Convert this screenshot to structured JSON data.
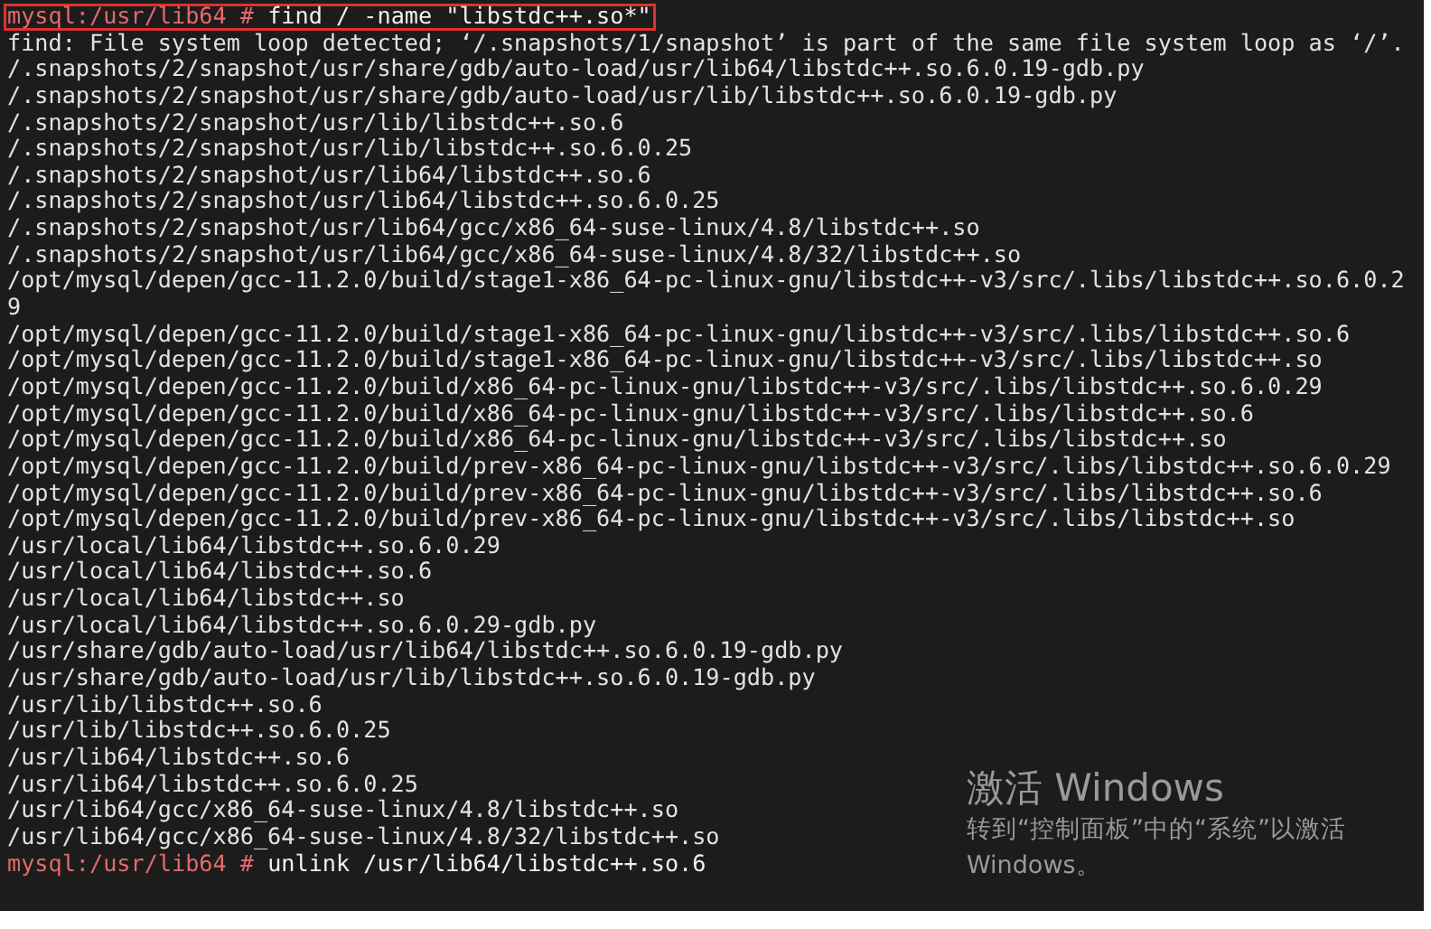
{
  "terminal": {
    "lines": [
      {
        "kind": "prompt",
        "prompt": "mysql:/usr/lib64 #",
        "command": "find / -name \"libstdc++.so*\"",
        "highlighted": true
      },
      {
        "kind": "output",
        "text": "find: File system loop detected; ‘/.snapshots/1/snapshot’ is part of the same file system loop as ‘/’."
      },
      {
        "kind": "output",
        "text": "/.snapshots/2/snapshot/usr/share/gdb/auto-load/usr/lib64/libstdc++.so.6.0.19-gdb.py"
      },
      {
        "kind": "output",
        "text": "/.snapshots/2/snapshot/usr/share/gdb/auto-load/usr/lib/libstdc++.so.6.0.19-gdb.py"
      },
      {
        "kind": "output",
        "text": "/.snapshots/2/snapshot/usr/lib/libstdc++.so.6"
      },
      {
        "kind": "output",
        "text": "/.snapshots/2/snapshot/usr/lib/libstdc++.so.6.0.25"
      },
      {
        "kind": "output",
        "text": "/.snapshots/2/snapshot/usr/lib64/libstdc++.so.6"
      },
      {
        "kind": "output",
        "text": "/.snapshots/2/snapshot/usr/lib64/libstdc++.so.6.0.25"
      },
      {
        "kind": "output",
        "text": "/.snapshots/2/snapshot/usr/lib64/gcc/x86_64-suse-linux/4.8/libstdc++.so"
      },
      {
        "kind": "output",
        "text": "/.snapshots/2/snapshot/usr/lib64/gcc/x86_64-suse-linux/4.8/32/libstdc++.so"
      },
      {
        "kind": "output",
        "text": "/opt/mysql/depen/gcc-11.2.0/build/stage1-x86_64-pc-linux-gnu/libstdc++-v3/src/.libs/libstdc++.so.6.0.2"
      },
      {
        "kind": "output",
        "text": "9"
      },
      {
        "kind": "output",
        "text": "/opt/mysql/depen/gcc-11.2.0/build/stage1-x86_64-pc-linux-gnu/libstdc++-v3/src/.libs/libstdc++.so.6"
      },
      {
        "kind": "output",
        "text": "/opt/mysql/depen/gcc-11.2.0/build/stage1-x86_64-pc-linux-gnu/libstdc++-v3/src/.libs/libstdc++.so"
      },
      {
        "kind": "output",
        "text": "/opt/mysql/depen/gcc-11.2.0/build/x86_64-pc-linux-gnu/libstdc++-v3/src/.libs/libstdc++.so.6.0.29"
      },
      {
        "kind": "output",
        "text": "/opt/mysql/depen/gcc-11.2.0/build/x86_64-pc-linux-gnu/libstdc++-v3/src/.libs/libstdc++.so.6"
      },
      {
        "kind": "output",
        "text": "/opt/mysql/depen/gcc-11.2.0/build/x86_64-pc-linux-gnu/libstdc++-v3/src/.libs/libstdc++.so"
      },
      {
        "kind": "output",
        "text": "/opt/mysql/depen/gcc-11.2.0/build/prev-x86_64-pc-linux-gnu/libstdc++-v3/src/.libs/libstdc++.so.6.0.29"
      },
      {
        "kind": "output",
        "text": "/opt/mysql/depen/gcc-11.2.0/build/prev-x86_64-pc-linux-gnu/libstdc++-v3/src/.libs/libstdc++.so.6"
      },
      {
        "kind": "output",
        "text": "/opt/mysql/depen/gcc-11.2.0/build/prev-x86_64-pc-linux-gnu/libstdc++-v3/src/.libs/libstdc++.so"
      },
      {
        "kind": "output",
        "text": "/usr/local/lib64/libstdc++.so.6.0.29"
      },
      {
        "kind": "output",
        "text": "/usr/local/lib64/libstdc++.so.6"
      },
      {
        "kind": "output",
        "text": "/usr/local/lib64/libstdc++.so"
      },
      {
        "kind": "output",
        "text": "/usr/local/lib64/libstdc++.so.6.0.29-gdb.py"
      },
      {
        "kind": "output",
        "text": "/usr/share/gdb/auto-load/usr/lib64/libstdc++.so.6.0.19-gdb.py"
      },
      {
        "kind": "output",
        "text": "/usr/share/gdb/auto-load/usr/lib/libstdc++.so.6.0.19-gdb.py"
      },
      {
        "kind": "output",
        "text": "/usr/lib/libstdc++.so.6"
      },
      {
        "kind": "output",
        "text": "/usr/lib/libstdc++.so.6.0.25"
      },
      {
        "kind": "output",
        "text": "/usr/lib64/libstdc++.so.6"
      },
      {
        "kind": "output",
        "text": "/usr/lib64/libstdc++.so.6.0.25"
      },
      {
        "kind": "output",
        "text": "/usr/lib64/gcc/x86_64-suse-linux/4.8/libstdc++.so"
      },
      {
        "kind": "output",
        "text": "/usr/lib64/gcc/x86_64-suse-linux/4.8/32/libstdc++.so"
      },
      {
        "kind": "prompt",
        "prompt": "mysql:/usr/lib64 #",
        "command": "unlink /usr/lib64/libstdc++.so.6",
        "highlighted": false
      }
    ]
  },
  "activation_notice": {
    "title": "激活 Windows",
    "message": "转到“控制面板”中的“系统”以激活 Windows。"
  }
}
